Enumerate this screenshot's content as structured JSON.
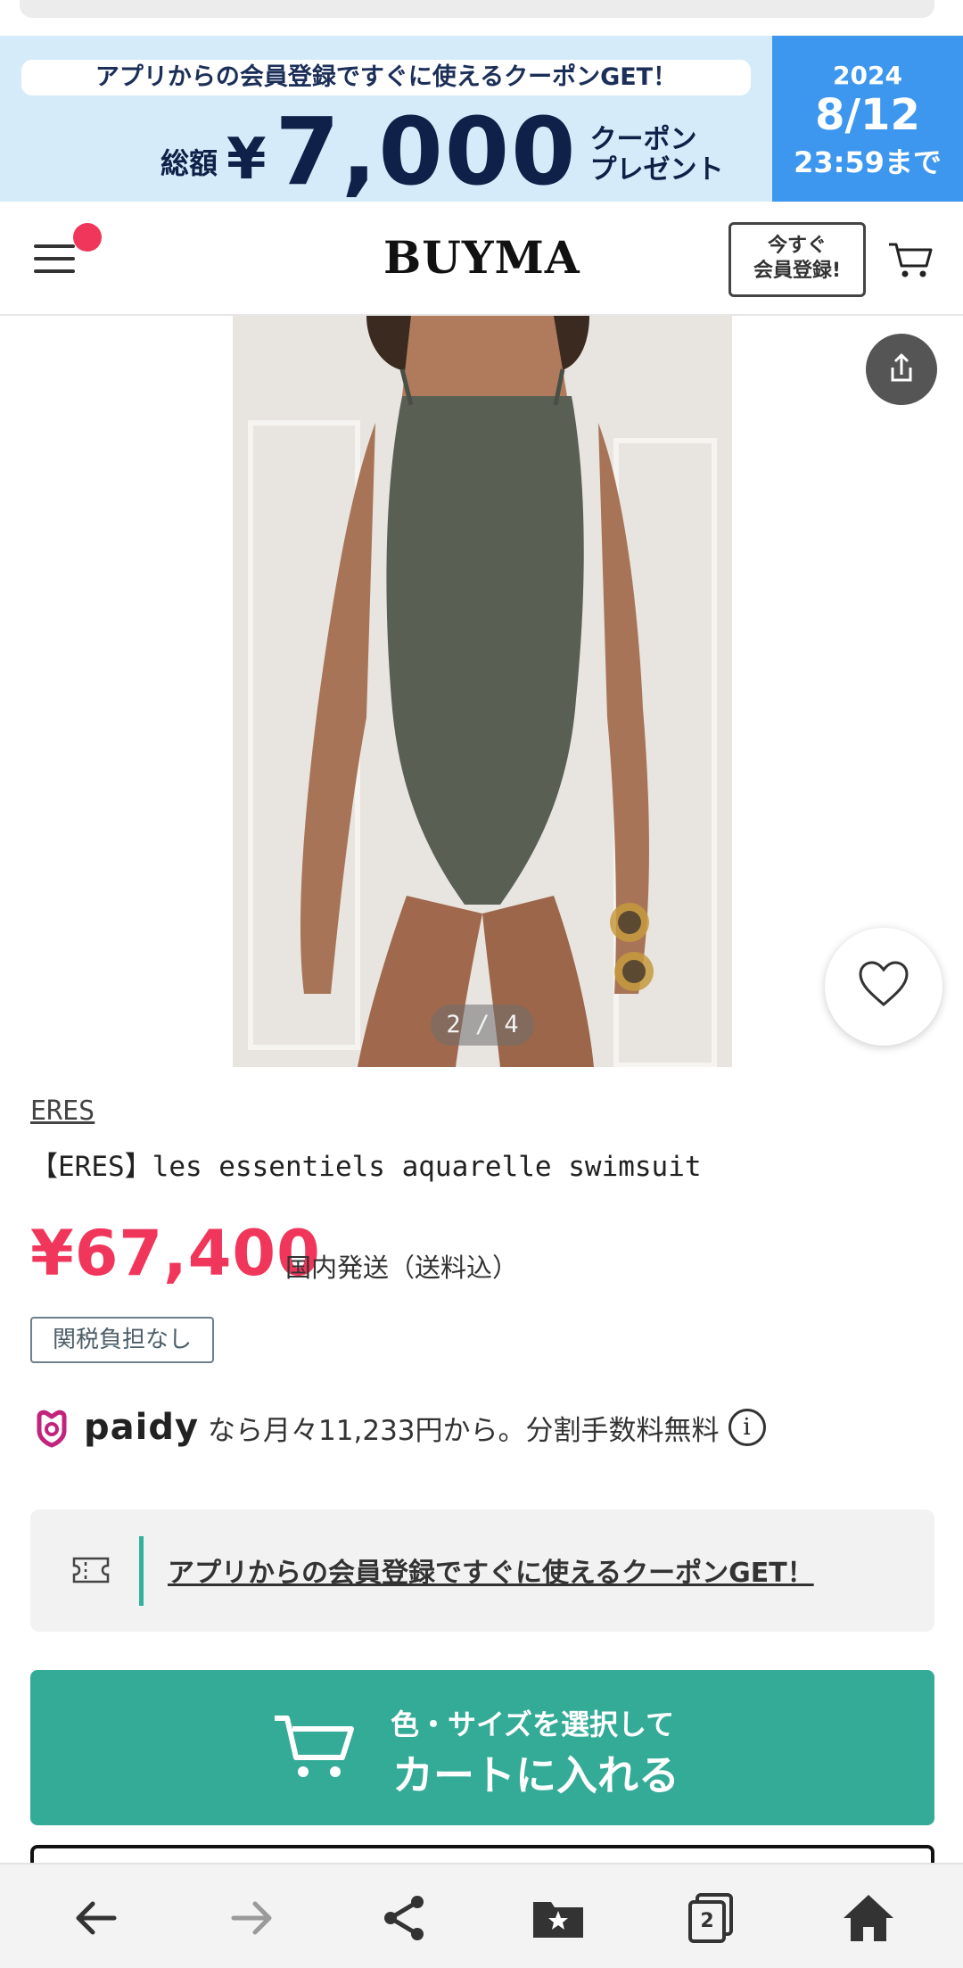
{
  "banner": {
    "headline": "アプリからの会員登録ですぐに使えるクーポンGET！",
    "total_label": "総額",
    "currency": "¥",
    "amount": "7,000",
    "coupon_line1": "クーポン",
    "coupon_line2": "プレゼント",
    "date_year": "2024",
    "date_day": "8/12",
    "date_time": "23:59まで"
  },
  "header": {
    "logo": "BUYMA",
    "register_line1": "今すぐ",
    "register_line2": "会員登録!"
  },
  "gallery": {
    "counter": "2 / 4"
  },
  "product": {
    "brand": "ERES",
    "title": "【ERES】les essentiels aquarelle swimsuit",
    "price": "¥67,400",
    "shipping": "国内発送（送料込）",
    "tax_tag": "関税負担なし"
  },
  "paidy": {
    "brand": "paidy",
    "text": "なら月々11,233円から。分割手数料無料",
    "info": "i"
  },
  "coupon": {
    "link": "アプリからの会員登録ですぐに使えるクーポンGET！"
  },
  "cart": {
    "line1": "色・サイズを選択して",
    "line2": "カートに入れる"
  },
  "bottom_nav": {
    "tabs_count": "2"
  },
  "colors": {
    "accent_pink": "#f0365a",
    "cart_green": "#34ab97",
    "banner_blue": "#3d97ef"
  }
}
